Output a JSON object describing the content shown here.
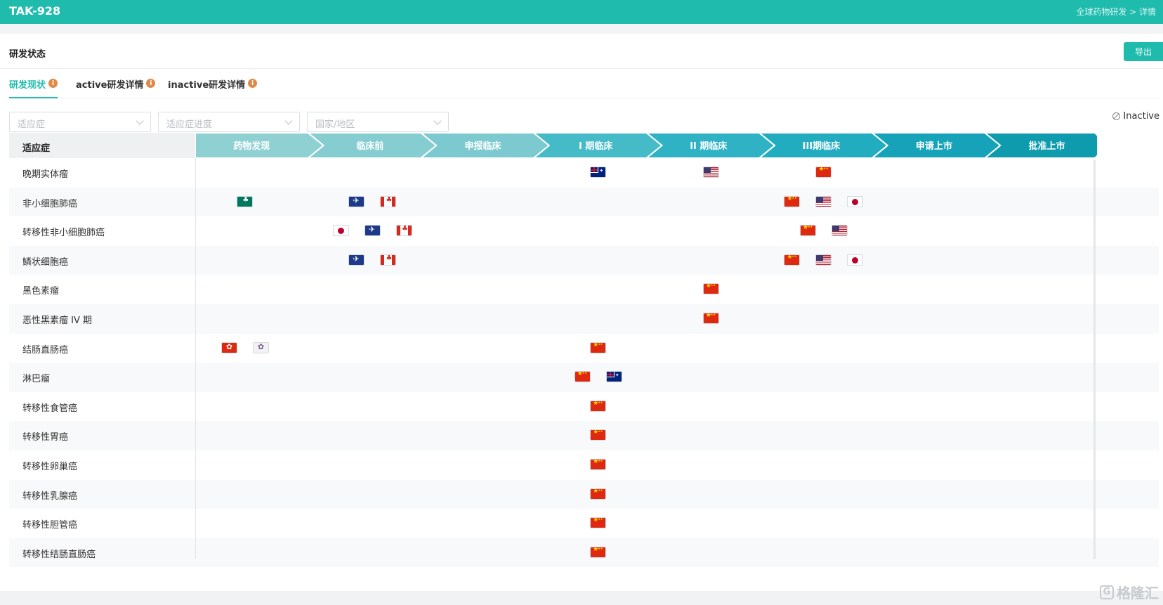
{
  "header": {
    "title": "TAK-928",
    "breadcrumb": "全球药物研发 > 详情"
  },
  "section": {
    "title": "研发状态",
    "export_label": "导出"
  },
  "tabs": [
    {
      "label": "研发现状",
      "active": true
    },
    {
      "label": "active研发详情",
      "active": false
    },
    {
      "label": "inactive研发详情",
      "active": false
    }
  ],
  "info_glyph": "i",
  "filters": [
    {
      "placeholder": "适应症"
    },
    {
      "placeholder": "适应症进度"
    },
    {
      "placeholder": "国家/地区"
    }
  ],
  "legend": {
    "inactive_label": "Inactive"
  },
  "table": {
    "indication_header": "适应症",
    "phases": [
      "药物发现",
      "临床前",
      "申报临床",
      "I 期临床",
      "II 期临床",
      "III期临床",
      "申请上市",
      "批准上市"
    ],
    "phase_colors": [
      "#8fd0d3",
      "#86cdd2",
      "#7ccad0",
      "#45bbc7",
      "#2fb3c4",
      "#22acc0",
      "#16a3b9",
      "#0f9bae"
    ],
    "rows": [
      {
        "indication": "晚期实体瘤",
        "entries": [
          {
            "phase": 3,
            "slot": 0,
            "country": "au"
          },
          {
            "phase": 4,
            "slot": 0,
            "country": "us"
          },
          {
            "phase": 5,
            "slot": 0,
            "country": "cn"
          }
        ]
      },
      {
        "indication": "非小细胞肺癌",
        "entries": [
          {
            "phase": 0,
            "slot": 0,
            "country": "mo"
          },
          {
            "phase": 1,
            "slot": -0.5,
            "country": "eu"
          },
          {
            "phase": 1,
            "slot": 0.5,
            "country": "ca"
          },
          {
            "phase": 5,
            "slot": -1,
            "country": "cn"
          },
          {
            "phase": 5,
            "slot": 0,
            "country": "us"
          },
          {
            "phase": 5,
            "slot": 1,
            "country": "jp"
          }
        ]
      },
      {
        "indication": "转移性非小细胞肺癌",
        "entries": [
          {
            "phase": 1,
            "slot": -1,
            "country": "jp"
          },
          {
            "phase": 1,
            "slot": 0,
            "country": "eu"
          },
          {
            "phase": 1,
            "slot": 1,
            "country": "ca"
          },
          {
            "phase": 5,
            "slot": -0.5,
            "country": "cn"
          },
          {
            "phase": 5,
            "slot": 0.5,
            "country": "us"
          }
        ]
      },
      {
        "indication": "鳞状细胞癌",
        "entries": [
          {
            "phase": 1,
            "slot": -0.5,
            "country": "eu"
          },
          {
            "phase": 1,
            "slot": 0.5,
            "country": "ca"
          },
          {
            "phase": 5,
            "slot": -1,
            "country": "cn"
          },
          {
            "phase": 5,
            "slot": 0,
            "country": "us"
          },
          {
            "phase": 5,
            "slot": 1,
            "country": "jp"
          }
        ]
      },
      {
        "indication": "黑色素瘤",
        "entries": [
          {
            "phase": 4,
            "slot": 0,
            "country": "cn"
          }
        ]
      },
      {
        "indication": "恶性黑素瘤 IV 期",
        "entries": [
          {
            "phase": 4,
            "slot": 0,
            "country": "cn"
          }
        ]
      },
      {
        "indication": "结肠直肠癌",
        "entries": [
          {
            "phase": 0,
            "slot": -0.5,
            "country": "hk"
          },
          {
            "phase": 0,
            "slot": 0.5,
            "country": "tw"
          },
          {
            "phase": 3,
            "slot": 0,
            "country": "cn"
          }
        ]
      },
      {
        "indication": "淋巴瘤",
        "entries": [
          {
            "phase": 3,
            "slot": -0.5,
            "country": "cn"
          },
          {
            "phase": 3,
            "slot": 0.5,
            "country": "au"
          }
        ]
      },
      {
        "indication": "转移性食管癌",
        "entries": [
          {
            "phase": 3,
            "slot": 0,
            "country": "cn"
          }
        ]
      },
      {
        "indication": "转移性胃癌",
        "entries": [
          {
            "phase": 3,
            "slot": 0,
            "country": "cn"
          }
        ]
      },
      {
        "indication": "转移性卵巢癌",
        "entries": [
          {
            "phase": 3,
            "slot": 0,
            "country": "cn"
          }
        ]
      },
      {
        "indication": "转移性乳腺癌",
        "entries": [
          {
            "phase": 3,
            "slot": 0,
            "country": "cn"
          }
        ]
      },
      {
        "indication": "转移性胆管癌",
        "entries": [
          {
            "phase": 3,
            "slot": 0,
            "country": "cn"
          }
        ]
      },
      {
        "indication": "转移性结肠直肠癌",
        "entries": [
          {
            "phase": 3,
            "slot": 0,
            "country": "cn"
          }
        ]
      }
    ]
  },
  "watermark": {
    "text": "格隆汇",
    "icon": "G"
  }
}
